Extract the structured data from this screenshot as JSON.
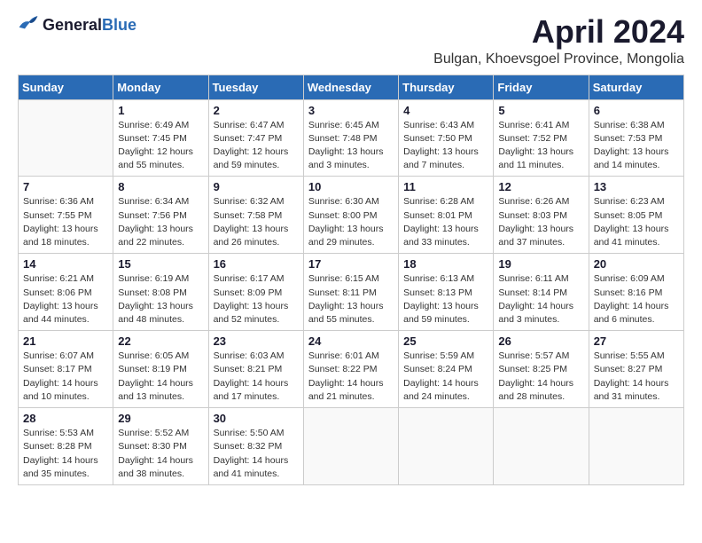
{
  "logo": {
    "general": "General",
    "blue": "Blue"
  },
  "title": "April 2024",
  "subtitle": "Bulgan, Khoevsgoel Province, Mongolia",
  "days_of_week": [
    "Sunday",
    "Monday",
    "Tuesday",
    "Wednesday",
    "Thursday",
    "Friday",
    "Saturday"
  ],
  "weeks": [
    [
      {
        "day": "",
        "sunrise": "",
        "sunset": "",
        "daylight": ""
      },
      {
        "day": "1",
        "sunrise": "Sunrise: 6:49 AM",
        "sunset": "Sunset: 7:45 PM",
        "daylight": "Daylight: 12 hours and 55 minutes."
      },
      {
        "day": "2",
        "sunrise": "Sunrise: 6:47 AM",
        "sunset": "Sunset: 7:47 PM",
        "daylight": "Daylight: 12 hours and 59 minutes."
      },
      {
        "day": "3",
        "sunrise": "Sunrise: 6:45 AM",
        "sunset": "Sunset: 7:48 PM",
        "daylight": "Daylight: 13 hours and 3 minutes."
      },
      {
        "day": "4",
        "sunrise": "Sunrise: 6:43 AM",
        "sunset": "Sunset: 7:50 PM",
        "daylight": "Daylight: 13 hours and 7 minutes."
      },
      {
        "day": "5",
        "sunrise": "Sunrise: 6:41 AM",
        "sunset": "Sunset: 7:52 PM",
        "daylight": "Daylight: 13 hours and 11 minutes."
      },
      {
        "day": "6",
        "sunrise": "Sunrise: 6:38 AM",
        "sunset": "Sunset: 7:53 PM",
        "daylight": "Daylight: 13 hours and 14 minutes."
      }
    ],
    [
      {
        "day": "7",
        "sunrise": "Sunrise: 6:36 AM",
        "sunset": "Sunset: 7:55 PM",
        "daylight": "Daylight: 13 hours and 18 minutes."
      },
      {
        "day": "8",
        "sunrise": "Sunrise: 6:34 AM",
        "sunset": "Sunset: 7:56 PM",
        "daylight": "Daylight: 13 hours and 22 minutes."
      },
      {
        "day": "9",
        "sunrise": "Sunrise: 6:32 AM",
        "sunset": "Sunset: 7:58 PM",
        "daylight": "Daylight: 13 hours and 26 minutes."
      },
      {
        "day": "10",
        "sunrise": "Sunrise: 6:30 AM",
        "sunset": "Sunset: 8:00 PM",
        "daylight": "Daylight: 13 hours and 29 minutes."
      },
      {
        "day": "11",
        "sunrise": "Sunrise: 6:28 AM",
        "sunset": "Sunset: 8:01 PM",
        "daylight": "Daylight: 13 hours and 33 minutes."
      },
      {
        "day": "12",
        "sunrise": "Sunrise: 6:26 AM",
        "sunset": "Sunset: 8:03 PM",
        "daylight": "Daylight: 13 hours and 37 minutes."
      },
      {
        "day": "13",
        "sunrise": "Sunrise: 6:23 AM",
        "sunset": "Sunset: 8:05 PM",
        "daylight": "Daylight: 13 hours and 41 minutes."
      }
    ],
    [
      {
        "day": "14",
        "sunrise": "Sunrise: 6:21 AM",
        "sunset": "Sunset: 8:06 PM",
        "daylight": "Daylight: 13 hours and 44 minutes."
      },
      {
        "day": "15",
        "sunrise": "Sunrise: 6:19 AM",
        "sunset": "Sunset: 8:08 PM",
        "daylight": "Daylight: 13 hours and 48 minutes."
      },
      {
        "day": "16",
        "sunrise": "Sunrise: 6:17 AM",
        "sunset": "Sunset: 8:09 PM",
        "daylight": "Daylight: 13 hours and 52 minutes."
      },
      {
        "day": "17",
        "sunrise": "Sunrise: 6:15 AM",
        "sunset": "Sunset: 8:11 PM",
        "daylight": "Daylight: 13 hours and 55 minutes."
      },
      {
        "day": "18",
        "sunrise": "Sunrise: 6:13 AM",
        "sunset": "Sunset: 8:13 PM",
        "daylight": "Daylight: 13 hours and 59 minutes."
      },
      {
        "day": "19",
        "sunrise": "Sunrise: 6:11 AM",
        "sunset": "Sunset: 8:14 PM",
        "daylight": "Daylight: 14 hours and 3 minutes."
      },
      {
        "day": "20",
        "sunrise": "Sunrise: 6:09 AM",
        "sunset": "Sunset: 8:16 PM",
        "daylight": "Daylight: 14 hours and 6 minutes."
      }
    ],
    [
      {
        "day": "21",
        "sunrise": "Sunrise: 6:07 AM",
        "sunset": "Sunset: 8:17 PM",
        "daylight": "Daylight: 14 hours and 10 minutes."
      },
      {
        "day": "22",
        "sunrise": "Sunrise: 6:05 AM",
        "sunset": "Sunset: 8:19 PM",
        "daylight": "Daylight: 14 hours and 13 minutes."
      },
      {
        "day": "23",
        "sunrise": "Sunrise: 6:03 AM",
        "sunset": "Sunset: 8:21 PM",
        "daylight": "Daylight: 14 hours and 17 minutes."
      },
      {
        "day": "24",
        "sunrise": "Sunrise: 6:01 AM",
        "sunset": "Sunset: 8:22 PM",
        "daylight": "Daylight: 14 hours and 21 minutes."
      },
      {
        "day": "25",
        "sunrise": "Sunrise: 5:59 AM",
        "sunset": "Sunset: 8:24 PM",
        "daylight": "Daylight: 14 hours and 24 minutes."
      },
      {
        "day": "26",
        "sunrise": "Sunrise: 5:57 AM",
        "sunset": "Sunset: 8:25 PM",
        "daylight": "Daylight: 14 hours and 28 minutes."
      },
      {
        "day": "27",
        "sunrise": "Sunrise: 5:55 AM",
        "sunset": "Sunset: 8:27 PM",
        "daylight": "Daylight: 14 hours and 31 minutes."
      }
    ],
    [
      {
        "day": "28",
        "sunrise": "Sunrise: 5:53 AM",
        "sunset": "Sunset: 8:28 PM",
        "daylight": "Daylight: 14 hours and 35 minutes."
      },
      {
        "day": "29",
        "sunrise": "Sunrise: 5:52 AM",
        "sunset": "Sunset: 8:30 PM",
        "daylight": "Daylight: 14 hours and 38 minutes."
      },
      {
        "day": "30",
        "sunrise": "Sunrise: 5:50 AM",
        "sunset": "Sunset: 8:32 PM",
        "daylight": "Daylight: 14 hours and 41 minutes."
      },
      {
        "day": "",
        "sunrise": "",
        "sunset": "",
        "daylight": ""
      },
      {
        "day": "",
        "sunrise": "",
        "sunset": "",
        "daylight": ""
      },
      {
        "day": "",
        "sunrise": "",
        "sunset": "",
        "daylight": ""
      },
      {
        "day": "",
        "sunrise": "",
        "sunset": "",
        "daylight": ""
      }
    ]
  ]
}
